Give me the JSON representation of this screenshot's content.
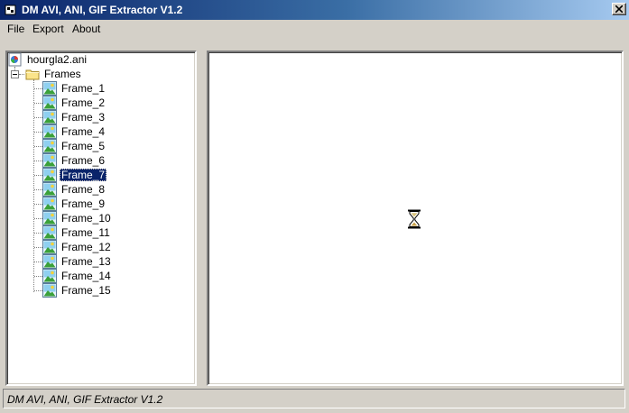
{
  "window": {
    "title": "DM AVI, ANI, GIF Extractor V1.2",
    "close_icon": "close-icon",
    "app_icon": "app-icon"
  },
  "menu": {
    "items": [
      {
        "label": "File"
      },
      {
        "label": "Export"
      },
      {
        "label": "About"
      }
    ]
  },
  "tree": {
    "root": {
      "label": "hourgla2.ani",
      "icon": "ani-file-icon"
    },
    "folder": {
      "label": "Frames",
      "icon": "folder-icon",
      "expanded": true
    },
    "frames": [
      {
        "label": "Frame_1"
      },
      {
        "label": "Frame_2"
      },
      {
        "label": "Frame_3"
      },
      {
        "label": "Frame_4"
      },
      {
        "label": "Frame_5"
      },
      {
        "label": "Frame_6"
      },
      {
        "label": "Frame_7",
        "selected": true
      },
      {
        "label": "Frame_8"
      },
      {
        "label": "Frame_9"
      },
      {
        "label": "Frame_10"
      },
      {
        "label": "Frame_11"
      },
      {
        "label": "Frame_12"
      },
      {
        "label": "Frame_13"
      },
      {
        "label": "Frame_14"
      },
      {
        "label": "Frame_15"
      }
    ],
    "frame_icon": "image-icon"
  },
  "preview": {
    "content_icon": "hourglass-icon"
  },
  "status": {
    "text": "DM AVI, ANI, GIF Extractor V1.2"
  },
  "colors": {
    "title_gradient_start": "#0a246a",
    "title_gradient_end": "#a6caf0",
    "selection": "#0a246a",
    "face": "#d4d0c8"
  }
}
